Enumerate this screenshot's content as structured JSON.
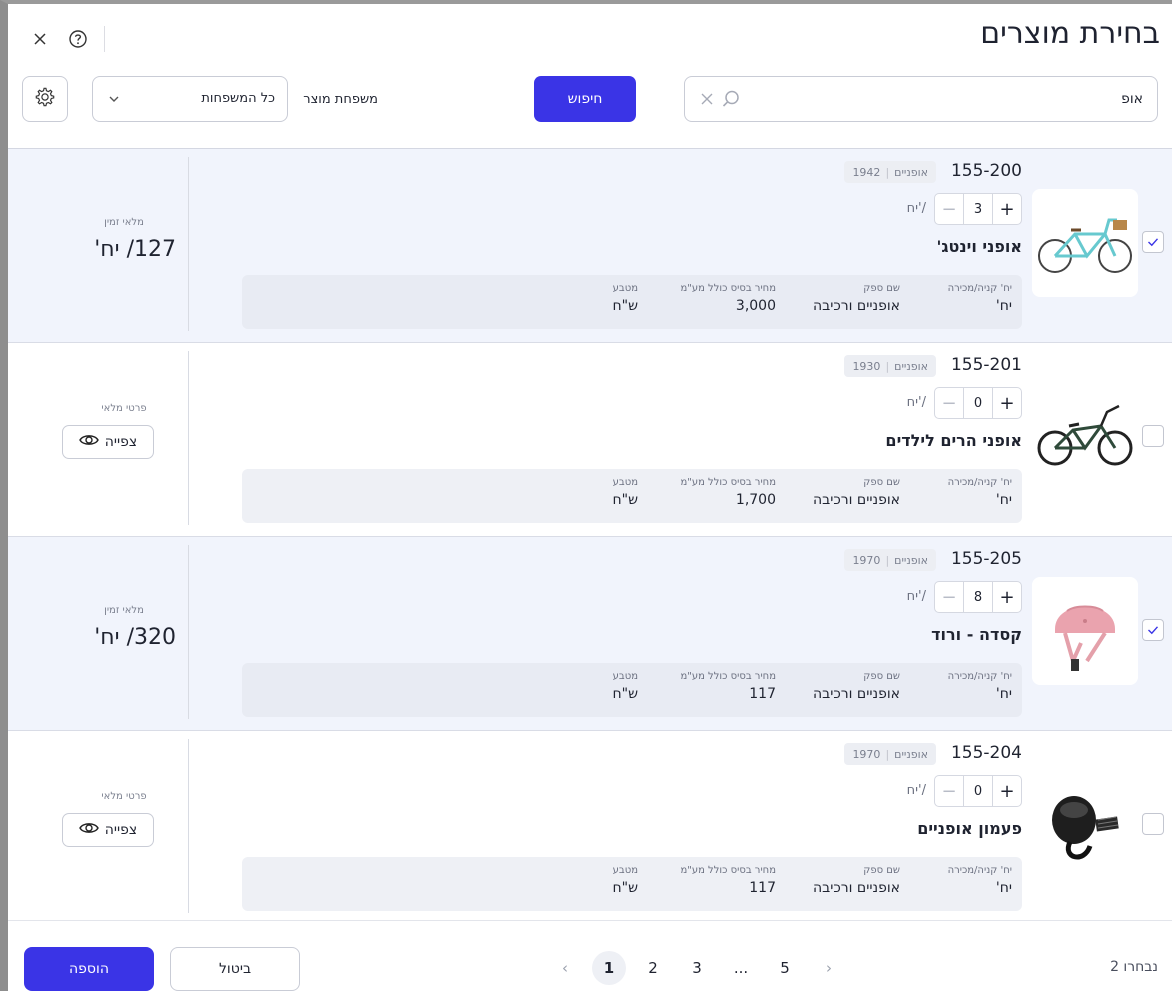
{
  "header": {
    "title": "בחירת מוצרים",
    "close_icon": "close-icon",
    "help_icon": "help-icon"
  },
  "toolbar": {
    "search_value": "אופ",
    "search_button": "חיפוש",
    "family_label": "משפחת מוצר",
    "family_value": "כל המשפחות",
    "settings_icon": "gear-icon"
  },
  "products": [
    {
      "code": "155-200",
      "category": "אופניים",
      "year": "1942",
      "qty": "3",
      "unit": "יח'/",
      "name": "אופני וינטג'",
      "meta_labels": [
        "יח' קניה/מכירה",
        "שם ספק",
        "מחיר בסיס כולל מע\"מ",
        "מטבע"
      ],
      "meta_values": [
        "יח'",
        "אופניים ורכיבה",
        "3,000",
        "ש\"ח"
      ],
      "selected": true,
      "side_label": "מלאי זמין",
      "side_value": "127/ יח'"
    },
    {
      "code": "155-201",
      "category": "אופניים",
      "year": "1930",
      "qty": "0",
      "unit": "יח'/",
      "name": "אופני הרים לילדים",
      "meta_labels": [
        "יח' קניה/מכירה",
        "שם ספק",
        "מחיר בסיס כולל מע\"מ",
        "מטבע"
      ],
      "meta_values": [
        "יח'",
        "אופניים ורכיבה",
        "1,700",
        "ש\"ח"
      ],
      "selected": false,
      "side_label": "פרטי מלאי",
      "side_button": "צפייה"
    },
    {
      "code": "155-205",
      "category": "אופניים",
      "year": "1970",
      "qty": "8",
      "unit": "יח'/",
      "name": "קסדה - ורוד",
      "meta_labels": [
        "יח' קניה/מכירה",
        "שם ספק",
        "מחיר בסיס כולל מע\"מ",
        "מטבע"
      ],
      "meta_values": [
        "יח'",
        "אופניים ורכיבה",
        "117",
        "ש\"ח"
      ],
      "selected": true,
      "side_label": "מלאי זמין",
      "side_value": "320/ יח'"
    },
    {
      "code": "155-204",
      "category": "אופניים",
      "year": "1970",
      "qty": "0",
      "unit": "יח'/",
      "name": "פעמון אופניים",
      "meta_labels": [
        "יח' קניה/מכירה",
        "שם ספק",
        "מחיר בסיס כולל מע\"מ",
        "מטבע"
      ],
      "meta_values": [
        "יח'",
        "אופניים ורכיבה",
        "117",
        "ש\"ח"
      ],
      "selected": false,
      "side_label": "פרטי מלאי",
      "side_button": "צפייה"
    }
  ],
  "footer": {
    "selected_count": "נבחרו 2",
    "pages": [
      "1",
      "2",
      "3",
      "...",
      "5"
    ],
    "current_page": "1",
    "cancel": "ביטול",
    "add": "הוספה"
  },
  "colors": {
    "accent": "#3a34e6",
    "selected_row": "#f1f4fc"
  }
}
